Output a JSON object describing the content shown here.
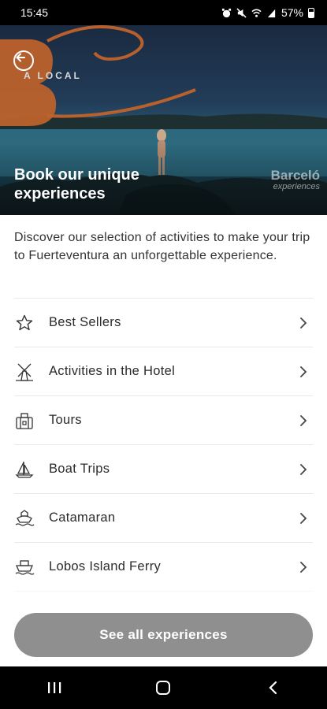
{
  "status_bar": {
    "time": "15:45",
    "battery": "57%"
  },
  "hero": {
    "badge_text": "A LOCAL",
    "title": "Book our unique experiences",
    "brand_name": "Barceló",
    "brand_sub": "experiences"
  },
  "intro": {
    "text": "Discover our selection of activities to make your trip to Fuerteventura an unforgettable experience."
  },
  "categories": [
    {
      "label": "Best Sellers",
      "icon": "star-icon"
    },
    {
      "label": "Activities in the Hotel",
      "icon": "windmill-icon"
    },
    {
      "label": "Tours",
      "icon": "luggage-icon"
    },
    {
      "label": "Boat Trips",
      "icon": "sailboat-icon"
    },
    {
      "label": "Catamaran",
      "icon": "catamaran-icon"
    },
    {
      "label": "Lobos Island Ferry",
      "icon": "ferry-icon"
    }
  ],
  "cta": {
    "label": "See all experiences"
  },
  "colors": {
    "accent_orange": "#c0632a",
    "cta_gray": "#8f8f8f"
  }
}
